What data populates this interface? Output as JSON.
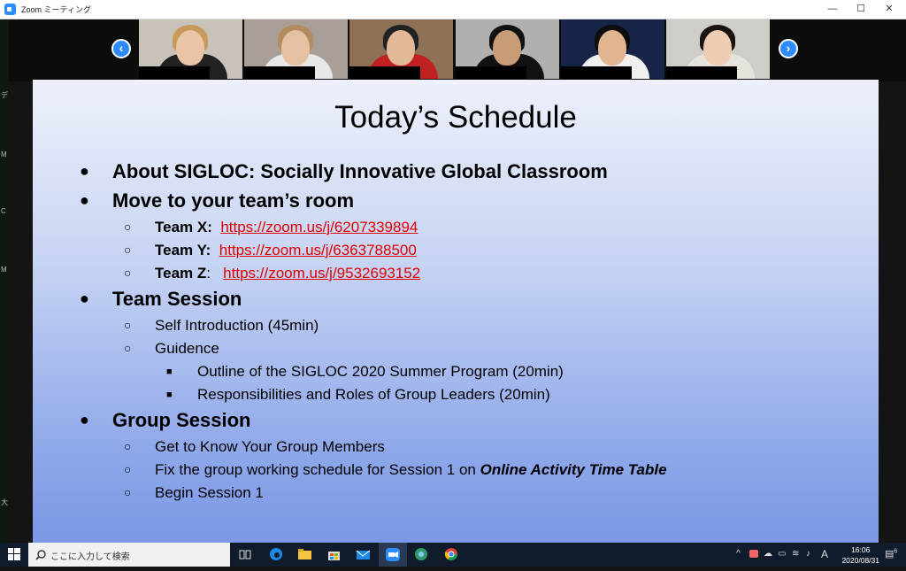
{
  "window": {
    "title": "Zoom ミーティング",
    "min": "—",
    "max": "☐",
    "close": "✕"
  },
  "gallery": {
    "prev_arrow": "‹",
    "next_arrow": "›",
    "participants": [
      {
        "bg": "#c9c2b8",
        "skin": "#e9c4a6",
        "hair": "#c59a5a",
        "body": "#222222"
      },
      {
        "bg": "#a89f96",
        "skin": "#e4c1a3",
        "hair": "#b38b5e",
        "body": "#e8e8e8"
      },
      {
        "bg": "#8d7056",
        "skin": "#e2b898",
        "hair": "#222222",
        "body": "#c02020"
      },
      {
        "bg": "#b0b0ae",
        "skin": "#c99c78",
        "hair": "#111111",
        "body": "#111111"
      },
      {
        "bg": "#162447",
        "skin": "#e0b58f",
        "hair": "#0e0e0e",
        "body": "#f0f0f0"
      },
      {
        "bg": "#cfcdc8",
        "skin": "#edcdb3",
        "hair": "#1c1410",
        "body": "#e6e2dc"
      }
    ]
  },
  "slide": {
    "title": "Today’s Schedule",
    "items": [
      {
        "level": 1,
        "bullet": "●",
        "text": "About SIGLOC: Socially Innovative Global Classroom"
      },
      {
        "level": 1,
        "bullet": "●",
        "text": "Move to your team’s room"
      },
      {
        "level": 2,
        "bullet": "○",
        "label": "Team X:",
        "link": "https://zoom.us/j/6207339894"
      },
      {
        "level": 2,
        "bullet": "○",
        "label": "Team Y:",
        "link": "https://zoom.us/j/6363788500"
      },
      {
        "level": 2,
        "bullet": "○",
        "label": "Team Z",
        "sep": ":",
        "link": "https://zoom.us/j/9532693152"
      },
      {
        "level": 1,
        "bullet": "●",
        "text": "Team Session"
      },
      {
        "level": 2,
        "bullet": "○",
        "text": "Self Introduction (45min)"
      },
      {
        "level": 2,
        "bullet": "○",
        "text": "Guidence"
      },
      {
        "level": 3,
        "bullet": "■",
        "text": "Outline of the SIGLOC 2020 Summer Program  (20min)"
      },
      {
        "level": 3,
        "bullet": "■",
        "text": "Responsibilities and Roles of Group Leaders (20min)"
      },
      {
        "level": 1,
        "bullet": "●",
        "text": "Group Session"
      },
      {
        "level": 2,
        "bullet": "○",
        "text": "Get to Know Your Group Members"
      },
      {
        "level": 2,
        "bullet": "○",
        "text": "Fix the group working schedule for Session 1 on ",
        "emph": "Online Activity Time Table"
      },
      {
        "level": 2,
        "bullet": "○",
        "text": "Begin Session 1"
      }
    ]
  },
  "desktop_strip": [
    "デ",
    "M",
    "C",
    "M",
    "大"
  ],
  "taskbar": {
    "search_placeholder": "ここに入力して検索",
    "time": "16:06",
    "date": "2020/08/31",
    "ime": "A",
    "notification_count": "6",
    "apps": [
      "task-view",
      "edge",
      "file-explorer",
      "store",
      "mail",
      "zoom",
      "chrome-alt",
      "chrome"
    ]
  }
}
